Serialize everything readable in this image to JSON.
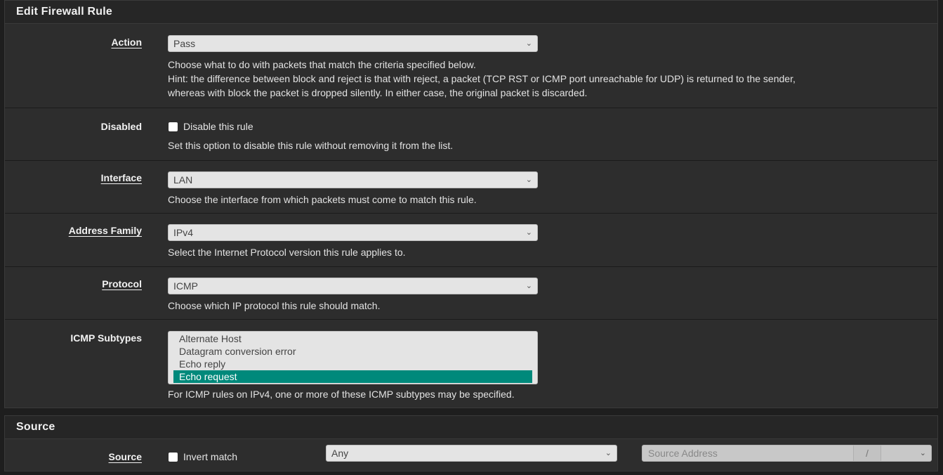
{
  "rule_panel": {
    "title": "Edit Firewall Rule",
    "action": {
      "label": "Action",
      "value": "Pass",
      "help": [
        "Choose what to do with packets that match the criteria specified below.",
        "Hint: the difference between block and reject is that with reject, a packet (TCP RST or ICMP port unreachable for UDP) is returned to the sender,",
        "whereas with block the packet is dropped silently. In either case, the original packet is discarded."
      ]
    },
    "disabled": {
      "label": "Disabled",
      "checkbox_label": "Disable this rule",
      "checked": false,
      "help": "Set this option to disable this rule without removing it from the list."
    },
    "interface": {
      "label": "Interface",
      "value": "LAN",
      "help": "Choose the interface from which packets must come to match this rule."
    },
    "address_family": {
      "label": "Address Family",
      "value": "IPv4",
      "help": "Select the Internet Protocol version this rule applies to."
    },
    "protocol": {
      "label": "Protocol",
      "value": "ICMP",
      "help": "Choose which IP protocol this rule should match."
    },
    "icmp_subtypes": {
      "label": "ICMP Subtypes",
      "options": [
        "Alternate Host",
        "Datagram conversion error",
        "Echo reply",
        "Echo request"
      ],
      "selected": "Echo request",
      "help": "For ICMP rules on IPv4, one or more of these ICMP subtypes may be specified."
    }
  },
  "source_panel": {
    "title": "Source",
    "label": "Source",
    "invert_label": "Invert match",
    "invert_checked": false,
    "type_value": "Any",
    "address_placeholder": "Source Address",
    "mask_separator": "/"
  },
  "colors": {
    "selected_option": "#00897b",
    "panel_bg": "#2d2d2d"
  }
}
